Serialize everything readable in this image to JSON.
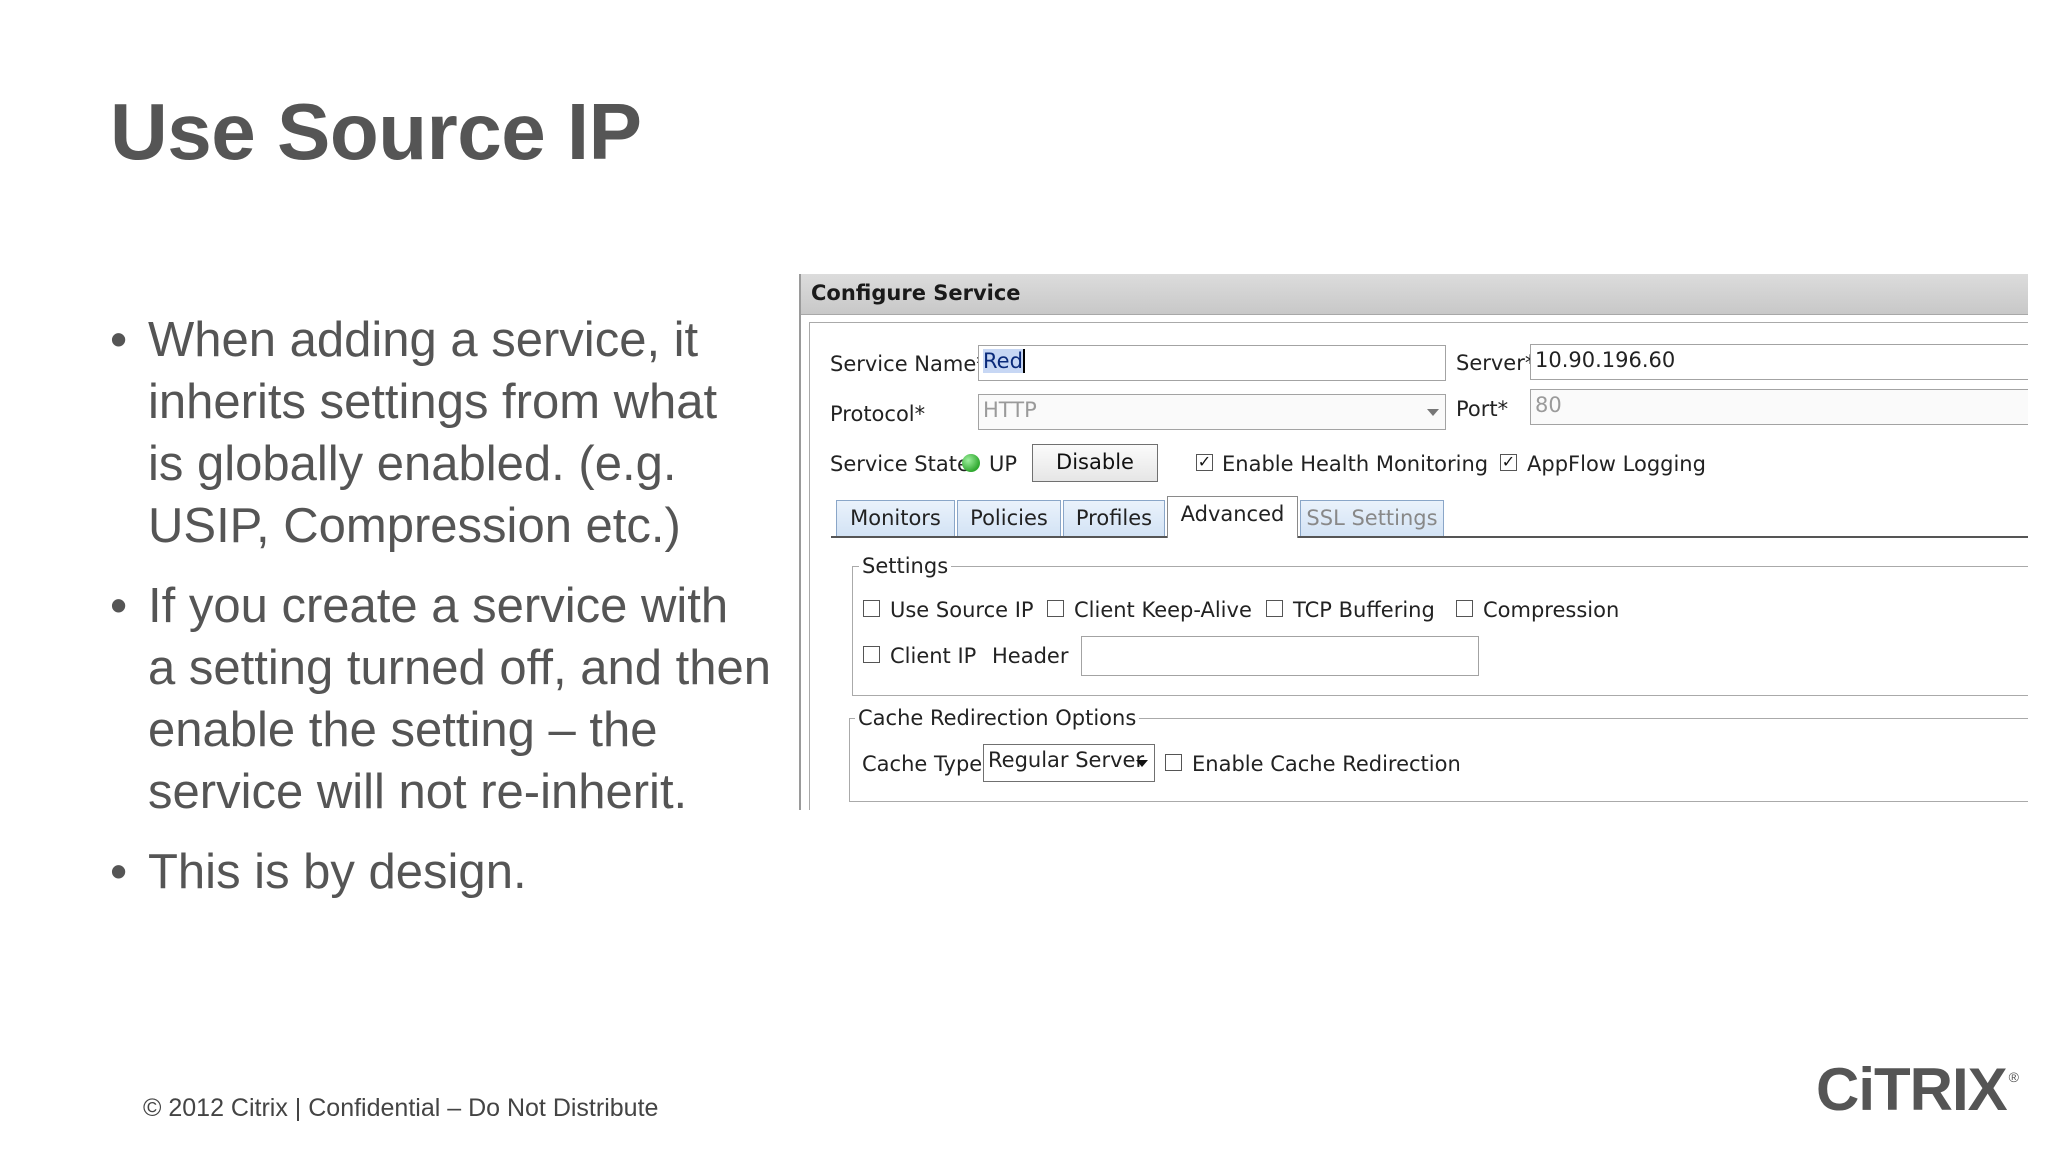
{
  "slide": {
    "title": "Use Source IP",
    "bullet_marker": "•",
    "bullets": [
      {
        "lines": [
          "When adding a service, it",
          "inherits settings from what",
          "is globally enabled. (e.g.",
          "USIP, Compression etc.)"
        ]
      },
      {
        "lines": [
          "If you create a service with",
          "a setting turned off, and then",
          "enable the setting – the",
          "service will not re-inherit."
        ]
      },
      {
        "lines": [
          "This is by design."
        ]
      }
    ],
    "footer": "© 2012 Citrix | Confidential – Do Not Distribute",
    "logo": "CiTRIX",
    "logo_mark": "®"
  },
  "dialog": {
    "title": "Configure Service",
    "service_name_label": "Service Name*",
    "service_name_value": "Red",
    "server_label": "Server*",
    "server_value": "10.90.196.60",
    "protocol_label": "Protocol*",
    "protocol_value": "HTTP",
    "port_label": "Port*",
    "port_value": "80",
    "service_state_label": "Service State",
    "service_state_value": "UP",
    "disable_button": "Disable",
    "enable_health_monitoring": {
      "label": "Enable Health Monitoring",
      "checked": true
    },
    "appflow_logging": {
      "label": "AppFlow Logging",
      "checked": true
    },
    "tabs": [
      {
        "label": "Monitors",
        "active": false
      },
      {
        "label": "Policies",
        "active": false
      },
      {
        "label": "Profiles",
        "active": false
      },
      {
        "label": "Advanced",
        "active": true
      },
      {
        "label": "SSL Settings",
        "active": false,
        "disabled": true
      }
    ],
    "settings_group": {
      "label": "Settings",
      "use_source_ip": {
        "label": "Use Source IP",
        "checked": false
      },
      "client_keep_alive": {
        "label": "Client Keep-Alive",
        "checked": false
      },
      "tcp_buffering": {
        "label": "TCP Buffering",
        "checked": false
      },
      "compression": {
        "label": "Compression",
        "checked": false
      },
      "client_ip": {
        "label": "Client IP",
        "checked": false
      },
      "header_label": "Header",
      "header_value": ""
    },
    "cache_group": {
      "label": "Cache Redirection Options",
      "cache_type_label": "Cache Type",
      "cache_type_value": "Regular Server",
      "enable_cache_redirection": {
        "label": "Enable Cache Redirection",
        "checked": false
      }
    },
    "colors": {
      "status_up": "#2fa82f",
      "tab_bg": "#d3e3f5",
      "selection": "#c7d7f4"
    },
    "icons": {
      "status": "green-dot-icon",
      "dropdown": "chevron-down-icon",
      "checkbox_checked": "checkmark-icon"
    }
  }
}
